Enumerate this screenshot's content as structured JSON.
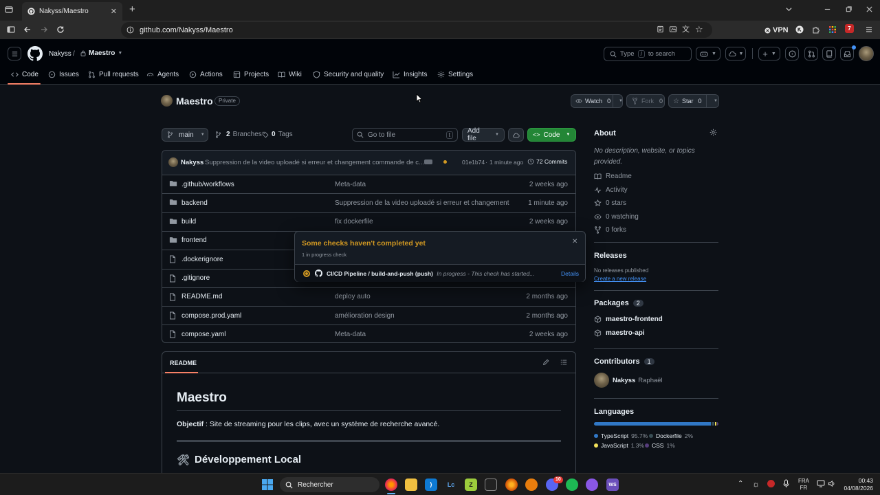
{
  "browser": {
    "tab_title": "Nakyss/Maestro",
    "url": "github.com/Nakyss/Maestro",
    "vpn_label": "VPN",
    "ext_badge": "7"
  },
  "header": {
    "owner": "Nakyss",
    "separator": "/",
    "repo": "Maestro",
    "search_placeholder_pre": "Type",
    "search_key": "/",
    "search_placeholder_post": "to search"
  },
  "nav": [
    "Code",
    "Issues",
    "Pull requests",
    "Agents",
    "Actions",
    "Projects",
    "Wiki",
    "Security and quality",
    "Insights",
    "Settings"
  ],
  "repo": {
    "name": "Maestro",
    "visibility": "Private",
    "watch_label": "Watch",
    "watch_count": "0",
    "fork_label": "Fork",
    "fork_count": "0",
    "star_label": "Star",
    "star_count": "0"
  },
  "toolbar": {
    "branch": "main",
    "branches_count": "2",
    "branches_label": "Branches",
    "tags_count": "0",
    "tags_label": "Tags",
    "goto_placeholder": "Go to file",
    "goto_key": "t",
    "add_file": "Add file",
    "code": "Code"
  },
  "commit": {
    "author": "Nakyss",
    "message": "Suppression de la video uploadé si erreur et changement commande de c...",
    "hash": "01e1b74",
    "sep": "·",
    "time": "1 minute ago",
    "commits": "72 Commits"
  },
  "files": [
    {
      "name": ".github/workflows",
      "type": "dir",
      "msg": "Meta-data",
      "date": "2 weeks ago"
    },
    {
      "name": "backend",
      "type": "dir",
      "msg": "Suppression de la video uploadé si erreur et changement co...",
      "date": "1 minute ago"
    },
    {
      "name": "build",
      "type": "dir",
      "msg": "fix dockerfile",
      "date": "2 weeks ago"
    },
    {
      "name": "frontend",
      "type": "dir",
      "msg": "",
      "date": ""
    },
    {
      "name": ".dockerignore",
      "type": "file",
      "msg": "",
      "date": ""
    },
    {
      "name": ".gitignore",
      "type": "file",
      "msg": "",
      "date": ""
    },
    {
      "name": "README.md",
      "type": "file",
      "msg": "deploy auto",
      "date": "2 months ago"
    },
    {
      "name": "compose.prod.yaml",
      "type": "file",
      "msg": "amélioration design",
      "date": "2 months ago"
    },
    {
      "name": "compose.yaml",
      "type": "file",
      "msg": "Meta-data",
      "date": "2 weeks ago"
    }
  ],
  "readme": {
    "tab": "README",
    "title": "Maestro",
    "objective_label": "Objectif",
    "objective_text": " : Site de streaming pour les clips, avec un système de recherche avancé.",
    "section": "Développement Local",
    "section_emoji": "🛠"
  },
  "popup": {
    "title": "Some checks haven't completed yet",
    "subtitle": "1 in progress check",
    "check_name": "CI/CD Pipeline / build-and-push (push)",
    "check_status": "In progress - This check has started...",
    "details": "Details"
  },
  "sidebar": {
    "about": "About",
    "description": "No description, website, or topics provided.",
    "links": [
      "Readme",
      "Activity",
      "0 stars",
      "0 watching",
      "0 forks"
    ],
    "releases": "Releases",
    "no_releases": "No releases published",
    "create_release": "Create a new release",
    "packages": "Packages",
    "packages_count": "2",
    "package_items": [
      "maestro-frontend",
      "maestro-api"
    ],
    "contributors": "Contributors",
    "contributors_count": "1",
    "contributor_name": "Nakyss",
    "contributor_full": "Raphaël",
    "languages": "Languages",
    "langs": [
      {
        "name": "TypeScript",
        "pct": "95.7%",
        "value": 95.7,
        "color": "#3178c6"
      },
      {
        "name": "Dockerfile",
        "pct": "2%",
        "value": 2,
        "color": "#384d54"
      },
      {
        "name": "JavaScript",
        "pct": "1.3%",
        "value": 1.3,
        "color": "#f1e05a"
      },
      {
        "name": "CSS",
        "pct": "1%",
        "value": 1,
        "color": "#563d7c"
      }
    ]
  },
  "taskbar": {
    "search": "Rechercher",
    "lang1": "FRA",
    "lang2": "FR",
    "time": "00:43",
    "date": "04/08/2026",
    "discord_badge": "10"
  }
}
